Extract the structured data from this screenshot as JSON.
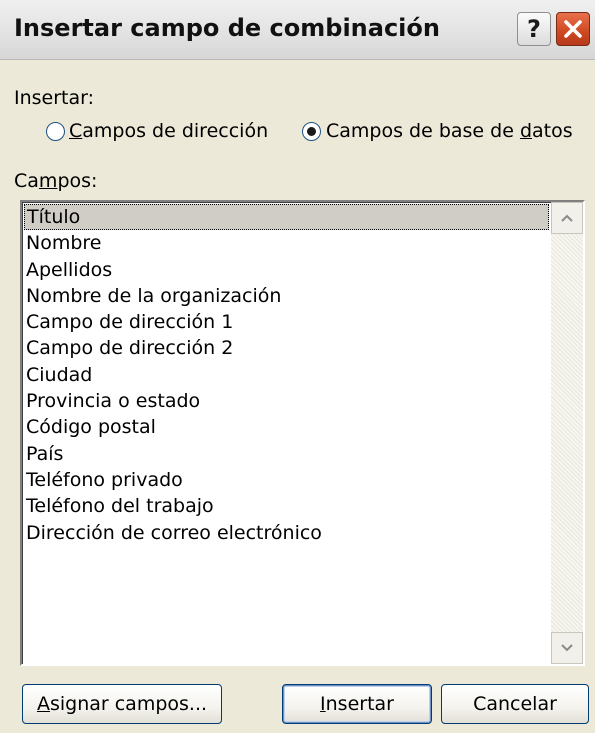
{
  "window": {
    "title": "Insertar campo de combinación",
    "help_glyph": "?",
    "close_glyph": "✕"
  },
  "insert_section": {
    "label": "Insertar:",
    "radio_options": [
      {
        "pre": "",
        "ul": "C",
        "post": "ampos de dirección",
        "selected": false
      },
      {
        "pre": "Campos de base de ",
        "ul": "d",
        "post": "atos",
        "selected": true
      }
    ]
  },
  "fields_section": {
    "label_pre": "Ca",
    "label_ul": "m",
    "label_post": "pos:",
    "items": [
      "Título",
      "Nombre",
      "Apellidos",
      "Nombre de la organización",
      "Campo de dirección 1",
      "Campo de dirección 2",
      "Ciudad",
      "Provincia o estado",
      "Código postal",
      "País",
      "Teléfono privado",
      "Teléfono del trabajo",
      "Dirección de correo electrónico"
    ],
    "selected_index": 0
  },
  "buttons": {
    "assign": {
      "ul": "A",
      "rest": "signar campos..."
    },
    "insert": {
      "ul": "I",
      "rest": "nsertar"
    },
    "cancel": {
      "label": "Cancelar"
    }
  },
  "colors": {
    "close_red": "#d14b24",
    "dialog_bg": "#ece9d8",
    "selection_bg": "#cfcdc6"
  },
  "icons": {
    "help": "question-mark-icon",
    "close": "close-x-icon",
    "scroll_up": "arrow-up-icon",
    "scroll_down": "arrow-down-icon"
  }
}
